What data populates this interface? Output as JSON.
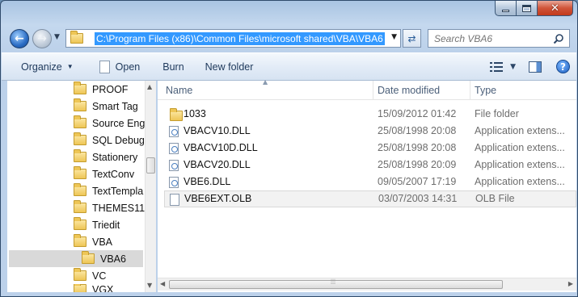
{
  "window": {
    "caption_buttons": [
      "minimize",
      "maximize",
      "close"
    ]
  },
  "address": {
    "path": "C:\\Program Files (x86)\\Common Files\\microsoft shared\\VBA\\VBA6"
  },
  "search": {
    "placeholder": "Search VBA6"
  },
  "toolbar": {
    "organize_label": "Organize",
    "open_label": "Open",
    "burn_label": "Burn",
    "new_folder_label": "New folder"
  },
  "nav_tree": {
    "items": [
      {
        "label": "PROOF"
      },
      {
        "label": "Smart Tag"
      },
      {
        "label": "Source Eng"
      },
      {
        "label": "SQL Debug"
      },
      {
        "label": "Stationery"
      },
      {
        "label": "TextConv"
      },
      {
        "label": "TextTempla"
      },
      {
        "label": "THEMES11"
      },
      {
        "label": "Triedit"
      },
      {
        "label": "VBA"
      },
      {
        "label": "VBA6",
        "selected": true
      },
      {
        "label": "VC"
      },
      {
        "label": "VGX"
      }
    ]
  },
  "columns": {
    "name": "Name",
    "date_modified": "Date modified",
    "type": "Type"
  },
  "files": [
    {
      "name": "1033",
      "date": "15/09/2012 01:42",
      "type": "File folder",
      "icon": "folder-icon"
    },
    {
      "name": "VBACV10.DLL",
      "date": "25/08/1998 20:08",
      "type": "Application extens...",
      "icon": "dll-icon"
    },
    {
      "name": "VBACV10D.DLL",
      "date": "25/08/1998 20:08",
      "type": "Application extens...",
      "icon": "dll-icon"
    },
    {
      "name": "VBACV20.DLL",
      "date": "25/08/1998 20:09",
      "type": "Application extens...",
      "icon": "dll-icon"
    },
    {
      "name": "VBE6.DLL",
      "date": "09/05/2007 17:19",
      "type": "Application extens...",
      "icon": "dll-icon"
    },
    {
      "name": "VBE6EXT.OLB",
      "date": "03/07/2003 14:31",
      "type": "OLB File",
      "icon": "file-icon",
      "selected": true
    }
  ],
  "colors": {
    "address_highlight": "#3399ff",
    "close_button": "#c2391b"
  }
}
